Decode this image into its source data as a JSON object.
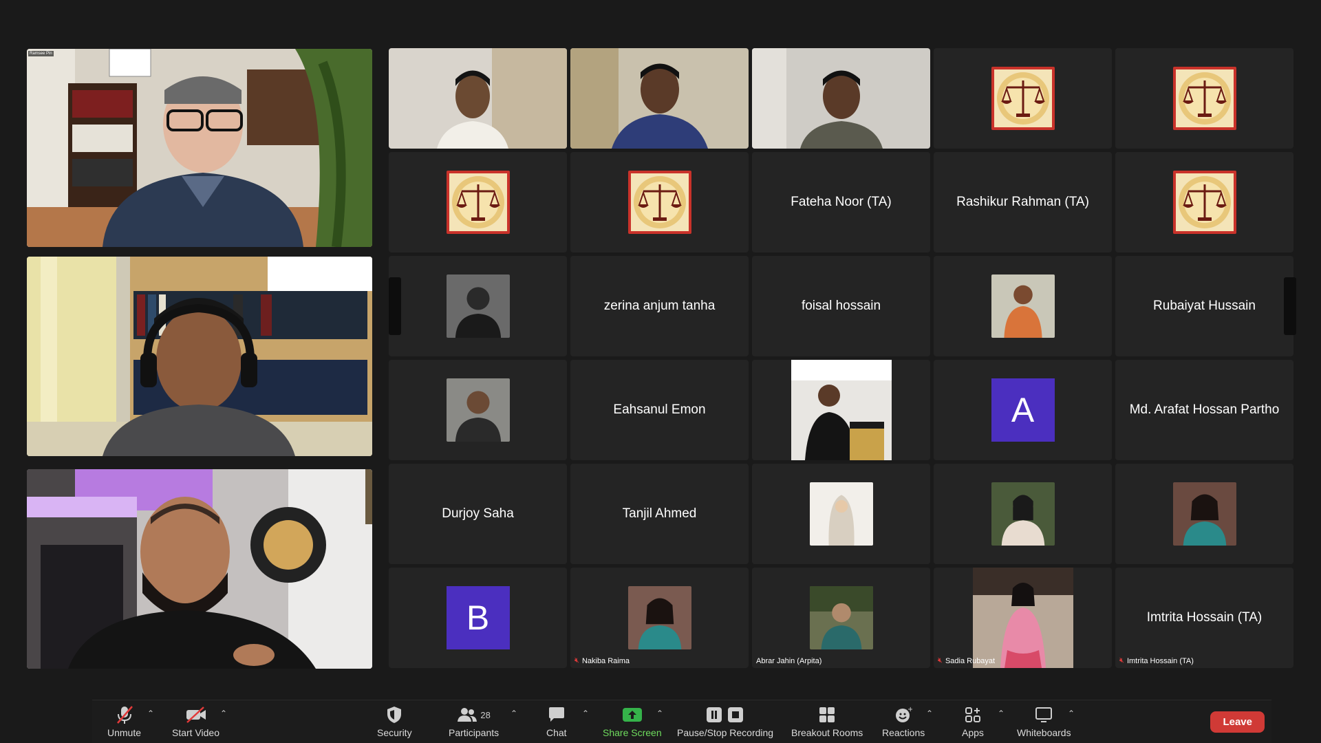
{
  "speakers": [
    {
      "id": "speaker-1",
      "tag": "Ramsee Pin"
    },
    {
      "id": "speaker-2"
    },
    {
      "id": "speaker-3"
    }
  ],
  "grid": {
    "names": {
      "r2c3": "Fateha Noor (TA)",
      "r2c4": "Rashikur Rahman (TA)",
      "r3c2": "zerina anjum tanha",
      "r3c3": "foisal hossain",
      "r3c5": "Rubaiyat Hussain",
      "r4c2": "Eahsanul Emon",
      "r4c5": "Md. Arafat Hossan Partho",
      "r5c1": "Durjoy Saha",
      "r5c2": "Tanjil Ahmed",
      "r6c5": "Imtrita Hossain (TA)"
    },
    "letters": {
      "r4c4": "A",
      "r6c1": "B"
    },
    "labels": {
      "r6c2": "Nakiba Raima",
      "r6c3": "Abrar Jahin (Arpita)",
      "r6c4": "Sadia Rubayat",
      "r6c5": "Imtrita Hossain (TA)"
    }
  },
  "toolbar": {
    "unmute": "Unmute",
    "start_video": "Start Video",
    "security": "Security",
    "participants": "Participants",
    "participants_count": "28",
    "chat": "Chat",
    "share_screen": "Share Screen",
    "pause_recording": "Pause/Stop Recording",
    "breakout": "Breakout Rooms",
    "reactions": "Reactions",
    "apps": "Apps",
    "whiteboards": "Whiteboards",
    "leave": "Leave"
  },
  "colors": {
    "background": "#1a1a1a",
    "tile": "#242424",
    "accent_green": "#6fdc5e",
    "leave_red": "#d03a36",
    "letter_avatar": "#4b2fbf"
  }
}
